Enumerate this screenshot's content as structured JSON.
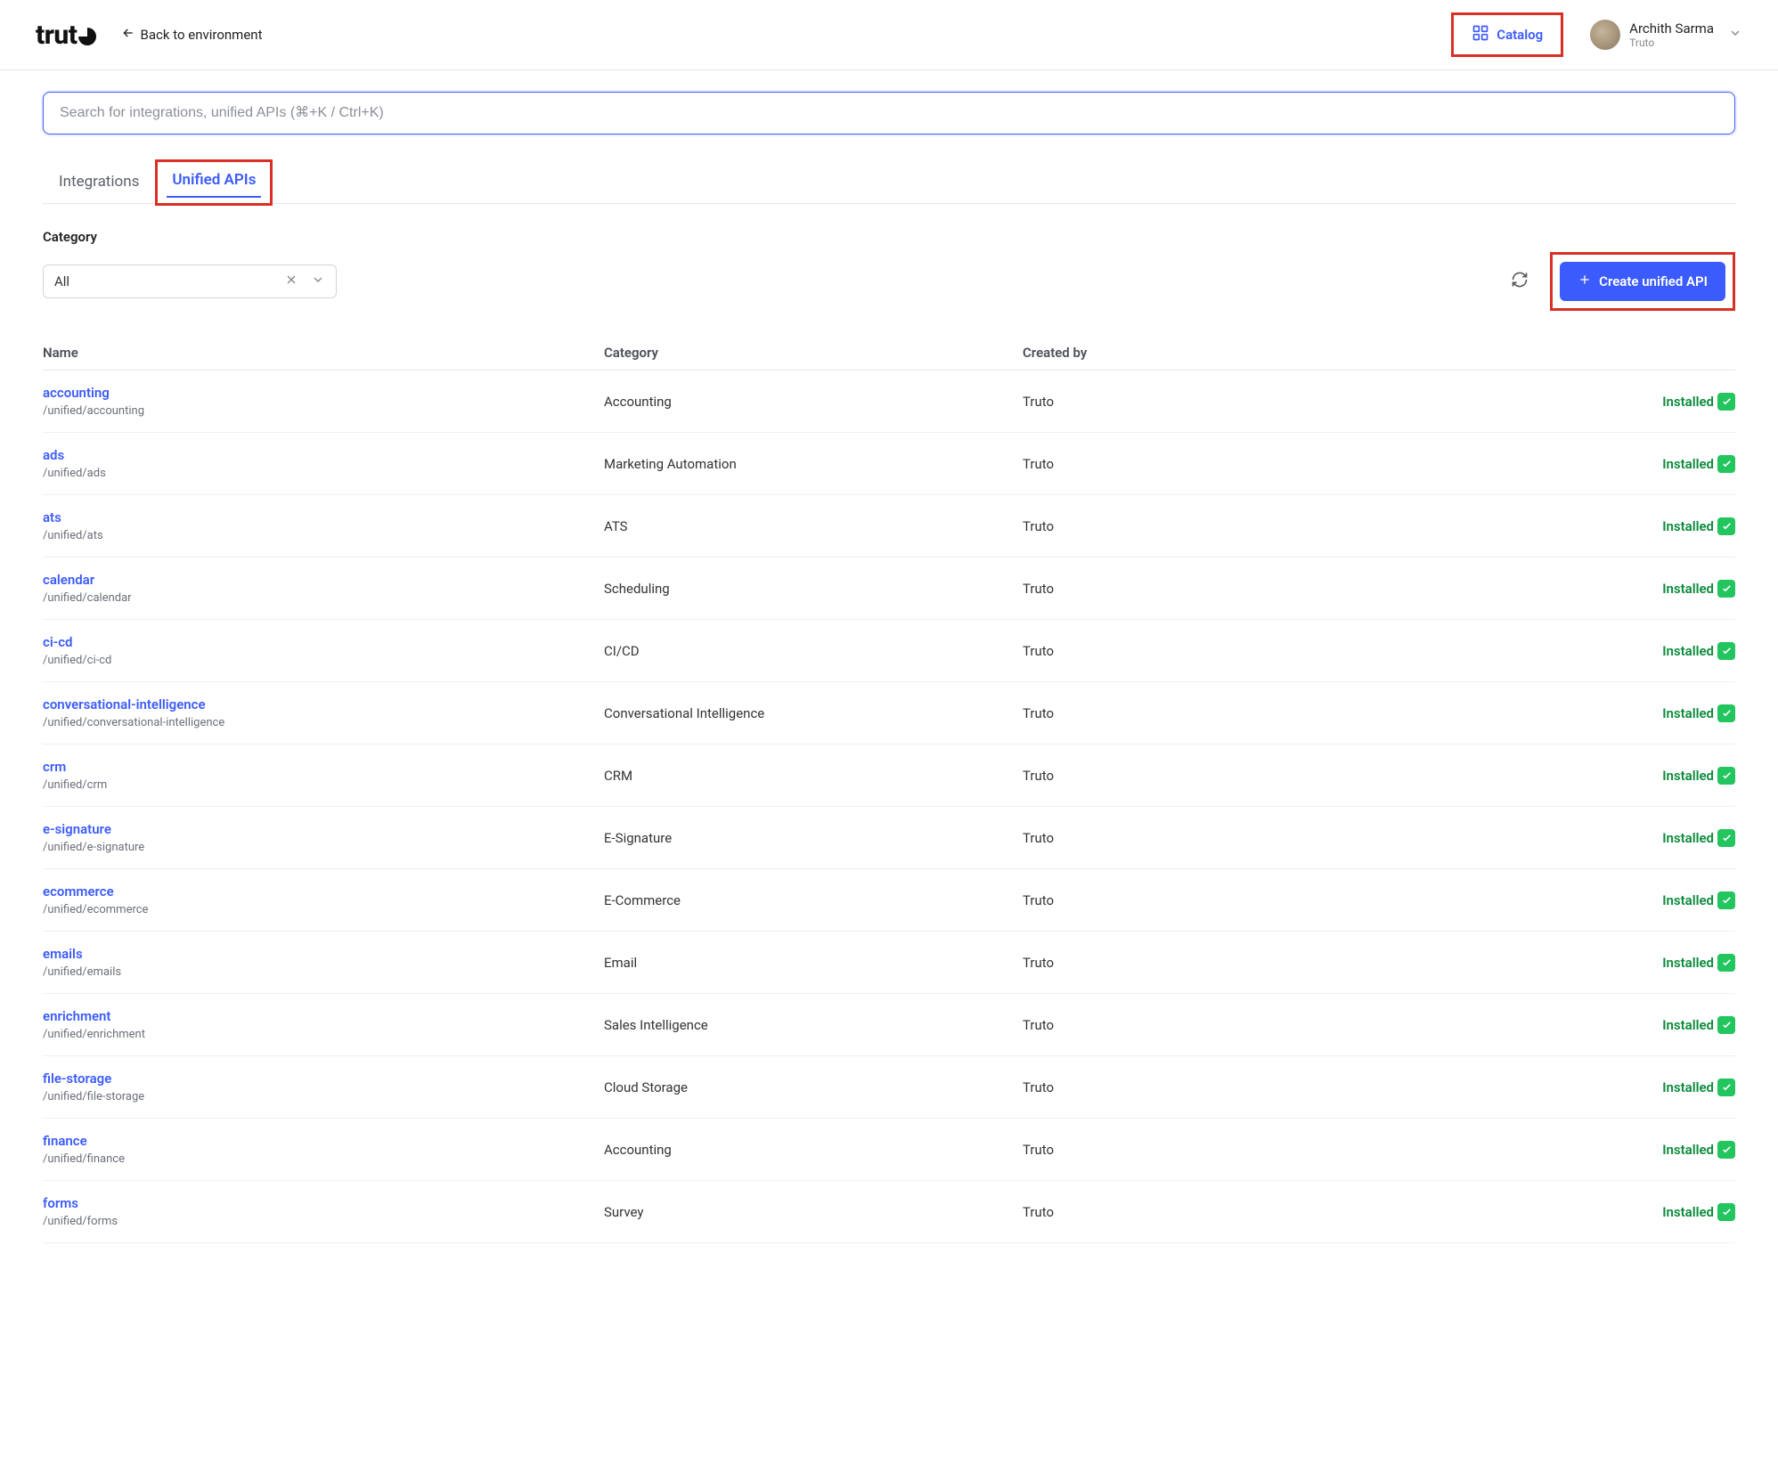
{
  "header": {
    "logo_text": "trut",
    "back_label": "Back to environment",
    "catalog_label": "Catalog",
    "user_name": "Archith Sarma",
    "user_org": "Truto"
  },
  "search": {
    "placeholder": "Search for integrations, unified APIs (⌘+K / Ctrl+K)"
  },
  "tabs": {
    "integrations": "Integrations",
    "unified_apis": "Unified APIs"
  },
  "filter": {
    "category_label": "Category",
    "selected": "All",
    "create_label": "Create unified API"
  },
  "table": {
    "headers": {
      "name": "Name",
      "category": "Category",
      "created_by": "Created by"
    },
    "status_label": "Installed",
    "rows": [
      {
        "name": "accounting",
        "path": "/unified/accounting",
        "category": "Accounting",
        "created_by": "Truto"
      },
      {
        "name": "ads",
        "path": "/unified/ads",
        "category": "Marketing Automation",
        "created_by": "Truto"
      },
      {
        "name": "ats",
        "path": "/unified/ats",
        "category": "ATS",
        "created_by": "Truto"
      },
      {
        "name": "calendar",
        "path": "/unified/calendar",
        "category": "Scheduling",
        "created_by": "Truto"
      },
      {
        "name": "ci-cd",
        "path": "/unified/ci-cd",
        "category": "CI/CD",
        "created_by": "Truto"
      },
      {
        "name": "conversational-intelligence",
        "path": "/unified/conversational-intelligence",
        "category": "Conversational Intelligence",
        "created_by": "Truto"
      },
      {
        "name": "crm",
        "path": "/unified/crm",
        "category": "CRM",
        "created_by": "Truto"
      },
      {
        "name": "e-signature",
        "path": "/unified/e-signature",
        "category": "E-Signature",
        "created_by": "Truto"
      },
      {
        "name": "ecommerce",
        "path": "/unified/ecommerce",
        "category": "E-Commerce",
        "created_by": "Truto"
      },
      {
        "name": "emails",
        "path": "/unified/emails",
        "category": "Email",
        "created_by": "Truto"
      },
      {
        "name": "enrichment",
        "path": "/unified/enrichment",
        "category": "Sales Intelligence",
        "created_by": "Truto"
      },
      {
        "name": "file-storage",
        "path": "/unified/file-storage",
        "category": "Cloud Storage",
        "created_by": "Truto"
      },
      {
        "name": "finance",
        "path": "/unified/finance",
        "category": "Accounting",
        "created_by": "Truto"
      },
      {
        "name": "forms",
        "path": "/unified/forms",
        "category": "Survey",
        "created_by": "Truto"
      }
    ]
  }
}
